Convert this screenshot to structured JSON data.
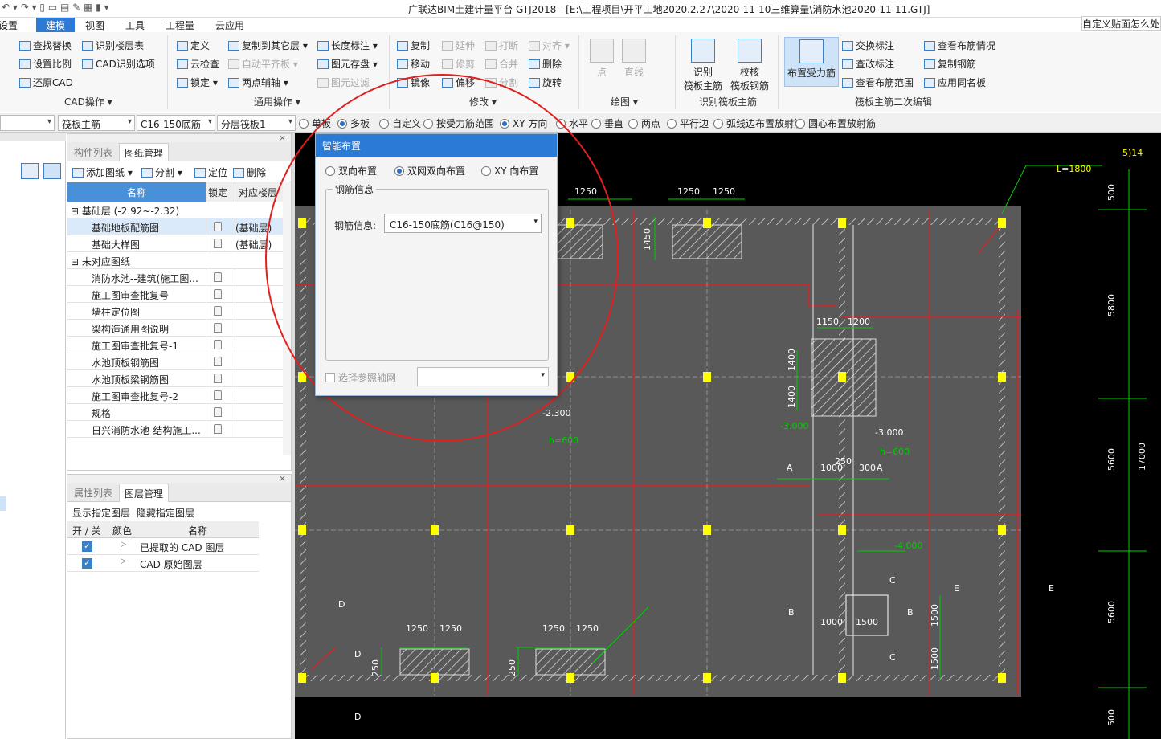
{
  "window": {
    "title": "广联达BIM土建计量平台 GTJ2018 - [E:\\工程项目\\开平工地2020.2.27\\2020-11-10三维算量\\消防水池2020-11-11.GTJ]",
    "search_placeholder": "自定义贴面怎么处理"
  },
  "menu": {
    "items": [
      "设置",
      "建模",
      "视图",
      "工具",
      "工程量",
      "云应用"
    ],
    "active": "建模"
  },
  "ribbon": {
    "cad": {
      "find_replace": "查找替换",
      "identify_floors": "识别楼层表",
      "set_scale": "设置比例",
      "cad_options": "CAD识别选项",
      "restore_cad": "还原CAD",
      "group": "CAD操作"
    },
    "common": {
      "define": "定义",
      "copy_to_floor": "复制到其它层",
      "length_mark": "长度标注",
      "cloud_check": "云检查",
      "auto_flat": "自动平齐板",
      "element_save": "图元存盘",
      "lock": "锁定",
      "two_point_axis": "两点辅轴",
      "element_filter": "图元过滤",
      "group": "通用操作"
    },
    "modify": {
      "copy": "复制",
      "extend": "延伸",
      "break": "打断",
      "align": "对齐",
      "move": "移动",
      "trim": "修剪",
      "merge": "合并",
      "delete": "删除",
      "mirror": "镜像",
      "offset": "偏移",
      "split": "分割",
      "rotate": "旋转",
      "group": "修改"
    },
    "draw": {
      "point": "点",
      "line": "直线",
      "group": "绘图"
    },
    "identify": {
      "identify_main": "识别\n筏板主筋",
      "check_main": "校核\n筏板钢筋",
      "group": "识别筏板主筋"
    },
    "secondary": {
      "layout_stress": "布置受力筋",
      "swap_mark": "交换标注",
      "view_rebar_info": "查看布筋情况",
      "check_mark": "查改标注",
      "copy_rebar": "复制钢筋",
      "view_rebar_range": "查看布筋范围",
      "apply_same_plate": "应用同名板",
      "group": "筏板主筋二次编辑"
    }
  },
  "options_bar": {
    "combos": [
      "",
      "筏板主筋",
      "C16-150底筋",
      "分层筏板1"
    ],
    "radios": [
      {
        "label": "单板",
        "on": false
      },
      {
        "label": "多板",
        "on": true
      },
      {
        "label": "自定义",
        "on": false
      },
      {
        "label": "按受力筋范围",
        "on": false
      },
      {
        "label": "XY 方向",
        "on": true
      },
      {
        "label": "水平",
        "on": false
      },
      {
        "label": "垂直",
        "on": false
      },
      {
        "label": "两点",
        "on": false
      },
      {
        "label": "平行边",
        "on": false
      },
      {
        "label": "弧线边布置放射筋",
        "on": false
      },
      {
        "label": "圆心布置放射筋",
        "on": false
      }
    ]
  },
  "drawing_panel": {
    "tabs": [
      "构件列表",
      "图纸管理"
    ],
    "active_tab": "图纸管理",
    "toolbar": [
      "添加图纸",
      "分割",
      "定位",
      "删除"
    ],
    "columns": [
      "名称",
      "锁定",
      "对应楼层"
    ],
    "groups": [
      {
        "label": "基础层 (-2.92~-2.32)",
        "items": [
          {
            "name": "基础地板配筋图",
            "floor": "(基础层)",
            "selected": true
          },
          {
            "name": "基础大样图",
            "floor": "(基础层)",
            "selected": false
          }
        ]
      },
      {
        "label": "未对应图纸",
        "items": [
          {
            "name": "消防水池--建筑(施工图...",
            "floor": ""
          },
          {
            "name": "施工图审查批复号",
            "floor": ""
          },
          {
            "name": "墙柱定位图",
            "floor": ""
          },
          {
            "name": "梁构造通用图说明",
            "floor": ""
          },
          {
            "name": "施工图审查批复号-1",
            "floor": ""
          },
          {
            "name": "水池顶板钢筋图",
            "floor": ""
          },
          {
            "name": "水池顶板梁钢筋图",
            "floor": ""
          },
          {
            "name": "施工图审查批复号-2",
            "floor": ""
          },
          {
            "name": "规格",
            "floor": ""
          },
          {
            "name": "日兴消防水池-结构施工...",
            "floor": ""
          }
        ]
      }
    ]
  },
  "layer_panel": {
    "tabs": [
      "属性列表",
      "图层管理"
    ],
    "active_tab": "图层管理",
    "actions": [
      "显示指定图层",
      "隐藏指定图层"
    ],
    "columns": [
      "开 / 关",
      "颜色",
      "名称"
    ],
    "rows": [
      {
        "name": "已提取的 CAD 图层",
        "on": true
      },
      {
        "name": "CAD 原始图层",
        "on": true
      }
    ]
  },
  "dialog": {
    "title": "智能布置",
    "modes": [
      {
        "label": "双向布置",
        "on": false
      },
      {
        "label": "双网双向布置",
        "on": true
      },
      {
        "label": "XY 向布置",
        "on": false
      }
    ],
    "group_label": "钢筋信息",
    "rebar_label": "钢筋信息:",
    "rebar_value": "C16-150底筋(C16@150)",
    "axis_checkbox": "选择参照轴网"
  },
  "cad": {
    "dims_top": [
      "1250",
      "1250",
      "1250"
    ],
    "dims_mid": [
      "1150",
      "1200"
    ],
    "dim_1450": "1450",
    "dims_v": [
      "1400",
      "1400"
    ],
    "elev": [
      "-2.300",
      "-3.000",
      "-3.000",
      "-4.000"
    ],
    "h600": [
      "h=600",
      "h=600"
    ],
    "sec_letters": [
      "A",
      "A",
      "B",
      "B",
      "C",
      "C",
      "D",
      "D",
      "D",
      "E",
      "E"
    ],
    "dims_1000": [
      "1000",
      "1000"
    ],
    "dim_250": "250",
    "dim_300": "300",
    "dim_1500": [
      "1500",
      "1500",
      "1500"
    ],
    "dims_bottom": [
      "1250",
      "1250",
      "1250",
      "1250"
    ],
    "right_dims": [
      "500",
      "5800",
      "5600",
      "17000",
      "5600",
      "500"
    ],
    "note_top": "L=1800",
    "note_top2": "5)14"
  },
  "colors": {
    "accent": "#2a7ad6",
    "canvas": "#000000",
    "slab": "#595959",
    "red": "#e02020",
    "green": "#00d000",
    "yellow": "#ffff00"
  }
}
